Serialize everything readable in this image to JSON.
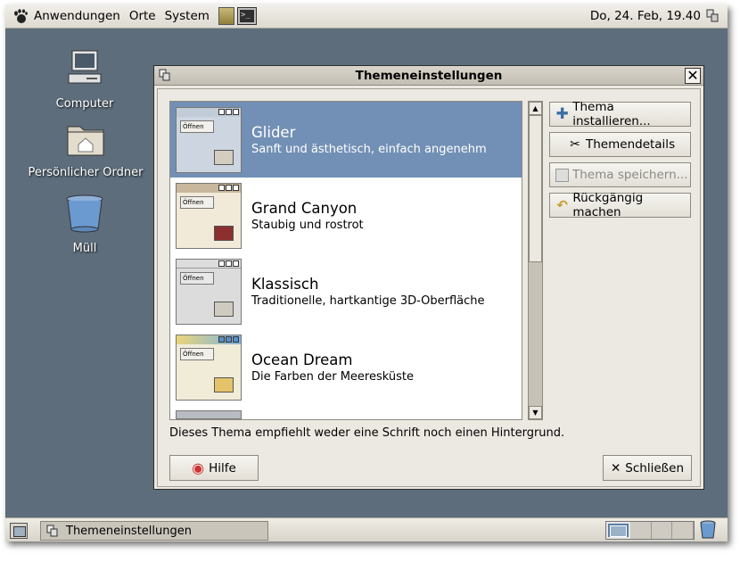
{
  "top_panel": {
    "menus": [
      "Anwendungen",
      "Orte",
      "System"
    ],
    "clock": "Do, 24. Feb, 19.40"
  },
  "desktop": {
    "icons": [
      {
        "label": "Computer",
        "icon": "computer-icon"
      },
      {
        "label": "Persönlicher Ordner",
        "icon": "home-folder-icon"
      },
      {
        "label": "Müll",
        "icon": "trash-icon"
      }
    ]
  },
  "window": {
    "title": "Themeneinstellungen",
    "themes": [
      {
        "name": "Glider",
        "description": "Sanft und ästhetisch, einfach angenehm",
        "selected": true,
        "thumb_label": "Öffnen"
      },
      {
        "name": "Grand Canyon",
        "description": "Staubig und rostrot",
        "selected": false,
        "thumb_label": "Öffnen"
      },
      {
        "name": "Klassisch",
        "description": "Traditionelle, hartkantige 3D-Oberfläche",
        "selected": false,
        "thumb_label": "Öffnen"
      },
      {
        "name": "Ocean Dream",
        "description": "Die Farben der Meeresküste",
        "selected": false,
        "thumb_label": "Öffnen"
      }
    ],
    "buttons": {
      "install": "Thema installieren...",
      "details": "Themendetails",
      "save": "Thema speichern...",
      "revert": "Rückgängig machen",
      "help": "Hilfe",
      "close": "Schließen"
    },
    "hint": "Dieses Thema empfiehlt weder eine Schrift noch einen Hintergrund."
  },
  "taskbar": {
    "task_label": "Themeneinstellungen"
  },
  "colors": {
    "desktop": "#5d6d7b",
    "selection": "#7290b5",
    "panel": "#e6e2d9"
  }
}
